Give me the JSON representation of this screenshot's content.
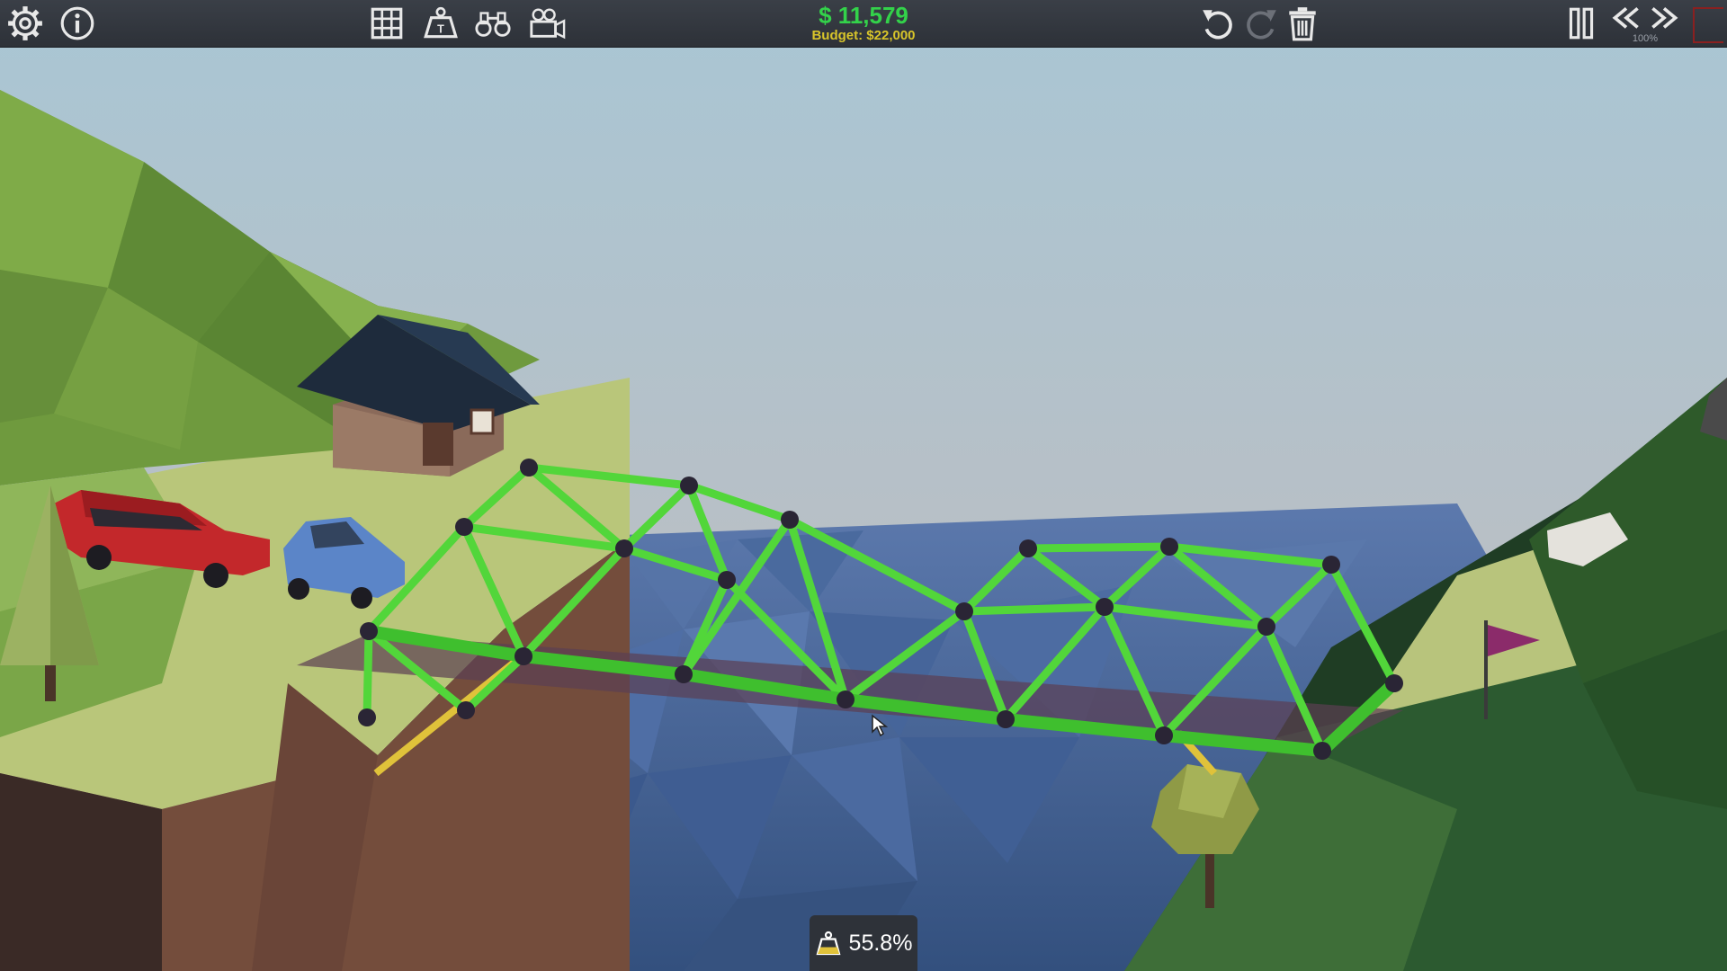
{
  "topbar": {
    "cost": "$ 11,579",
    "budget": "Budget: $22,000",
    "speed": "100%",
    "left_icons": [
      "gear-icon",
      "info-icon"
    ],
    "tool_icons": [
      "grid-icon",
      "weight-icon",
      "binoculars-icon",
      "camera-icon"
    ],
    "edit_icons": [
      "undo-icon",
      "redo-icon",
      "trash-icon"
    ],
    "playback_icons": [
      "pause-icon",
      "slower-icon",
      "faster-icon"
    ],
    "cost_color": "#33d24a",
    "budget_color": "#d8c52a"
  },
  "stress": {
    "value": "55.8%",
    "icon": "weight-icon"
  },
  "colors": {
    "road_beam": "#3fbf2e",
    "truss_beam": "#52d63a",
    "joint": "#2a2535",
    "water": "#3d5b8f",
    "grass": "#a8c46a",
    "cliff": "#6e4a3b",
    "support_cable": "#e0c23a"
  }
}
